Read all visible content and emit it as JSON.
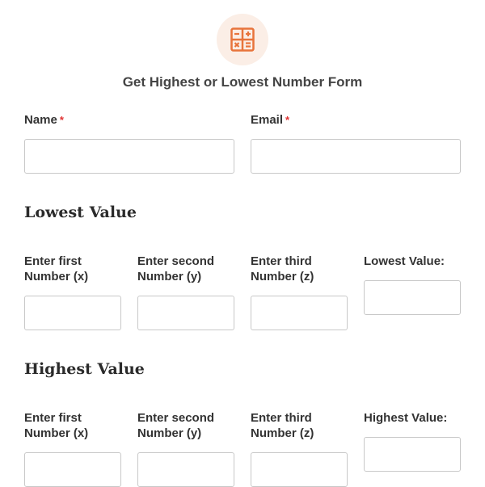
{
  "header": {
    "icon": "calculator-icon",
    "accent_color": "#e8743b",
    "title": "Get Highest or Lowest Number Form"
  },
  "contact": {
    "name_label": "Name",
    "email_label": "Email",
    "required_marker": "*",
    "name_value": "",
    "email_value": ""
  },
  "sections": [
    {
      "heading": "Lowest Value",
      "fields": [
        {
          "line1": "Enter first",
          "line2": "Number (x)",
          "value": ""
        },
        {
          "line1": "Enter second",
          "line2": "Number (y)",
          "value": ""
        },
        {
          "line1": "Enter third",
          "line2": "Number (z)",
          "value": ""
        },
        {
          "line1": "Lowest Value:",
          "line2": "",
          "value": ""
        }
      ]
    },
    {
      "heading": "Highest Value",
      "fields": [
        {
          "line1": "Enter first",
          "line2": "Number (x)",
          "value": ""
        },
        {
          "line1": "Enter second",
          "line2": "Number (y)",
          "value": ""
        },
        {
          "line1": "Enter third",
          "line2": "Number (z)",
          "value": ""
        },
        {
          "line1": "Highest Value:",
          "line2": "",
          "value": ""
        }
      ]
    }
  ]
}
